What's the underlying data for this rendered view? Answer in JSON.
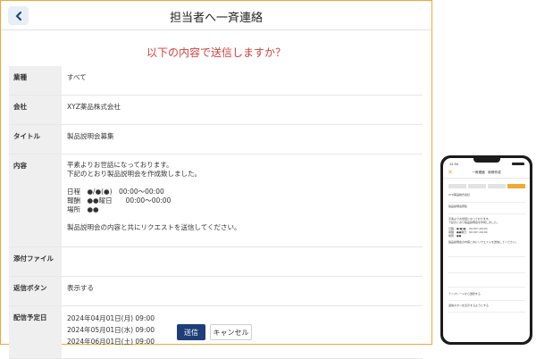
{
  "header": {
    "title": "担当者へ一斉連絡",
    "back_icon": "chevron-left-icon"
  },
  "confirm_question": "以下の内容で送信しますか？",
  "details": {
    "industry": {
      "label": "業種",
      "value": "すべて"
    },
    "company": {
      "label": "会社",
      "value": "XYZ薬品株式会社"
    },
    "title": {
      "label": "タイトル",
      "value": "製品説明会募集"
    },
    "body": {
      "label": "内容",
      "lines": [
        "平素よりお世話になっております。",
        "下記のとおり製品説明会を作成致しました。",
        "日程　●/●(●)　00:00〜00:00",
        "報酬　●●曜日　　00:00〜00:00",
        "場所　●●",
        "製品説明会の内容と共にリクエストを送信してください。"
      ]
    },
    "attachment": {
      "label": "添付ファイル",
      "value": ""
    },
    "reply_button": {
      "label": "返信ボタン",
      "value": "表示する"
    },
    "schedule": {
      "label": "配信予定日",
      "dates": [
        "2024年04月01日(月) 09:00",
        "2024年05月01日(水) 09:00",
        "2024年06月01日(土) 09:00"
      ]
    }
  },
  "buttons": {
    "send": "送信",
    "cancel": "キャンセル"
  },
  "colors": {
    "accent": "#f0a836",
    "alert": "#d0413b",
    "primary": "#1d3e78"
  },
  "phone": {
    "time": "12:34",
    "title": "一斉連絡　新規作成",
    "close_icon": "close-icon",
    "company_value": "XYZ薬品株式会社",
    "title_value": "製品説明会募集",
    "body_lines": [
      "平素よりお世話になっております。",
      "下記のとおり製品説明会を作成しました。",
      "日程　●/●(●)　00:00〜00:00",
      "報酬　●●曜日　00:00〜00:00",
      "場所　●●",
      "製品説明会の内容と共にリクエストを送信してください。"
    ],
    "template_option": "テンプレートから選択する",
    "reply_option": "返信ボタンを表示するようにする"
  }
}
